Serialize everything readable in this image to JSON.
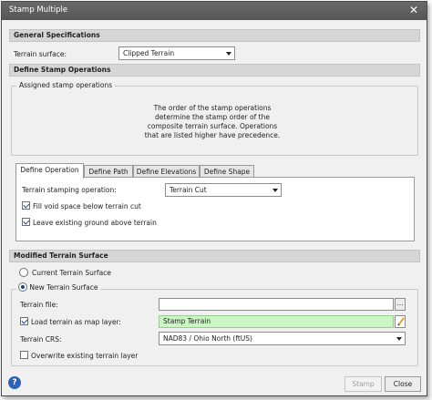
{
  "window": {
    "title": "Stamp Multiple",
    "close_glyph": "✕"
  },
  "general": {
    "header": "General Specifications",
    "terrain_surface_label": "Terrain surface:",
    "terrain_surface_value": "Clipped Terrain"
  },
  "define_stamp": {
    "header": "Define Stamp Operations",
    "assigned_legend": "Assigned stamp operations",
    "note_lines": [
      "The order of the stamp operations",
      "determine the stamp order of the",
      "composite terrain surface. Operations",
      "that are listed higher have precedence."
    ]
  },
  "tabs": [
    {
      "label": "Define Operation",
      "active": true
    },
    {
      "label": "Define Path",
      "active": false
    },
    {
      "label": "Define Elevations",
      "active": false
    },
    {
      "label": "Define Shape",
      "active": false
    }
  ],
  "operation": {
    "stamping_label": "Terrain stamping operation:",
    "stamping_value": "Terrain Cut",
    "fill_void_label": "Fill void space below terrain cut",
    "fill_void_checked": true,
    "leave_ground_label": "Leave existing ground above terrain",
    "leave_ground_checked": true
  },
  "modified": {
    "header": "Modified Terrain Surface",
    "current_label": "Current Terrain Surface",
    "current_selected": false,
    "new_legend": "New Terrain Surface",
    "new_selected": true,
    "terrain_file_label": "Terrain file:",
    "terrain_file_value": "",
    "browse_label": "...",
    "load_map_label": "Load terrain as map layer:",
    "load_map_checked": true,
    "layer_name_value": "Stamp Terrain",
    "crs_label": "Terrain CRS:",
    "crs_value": "NAD83 / Ohio North (ftUS)",
    "overwrite_label": "Overwrite existing terrain layer",
    "overwrite_checked": false
  },
  "footer": {
    "help_glyph": "?",
    "stamp_label": "Stamp",
    "close_label": "Close"
  },
  "icons": {
    "close": "close-icon",
    "pencil": "pencil-icon",
    "help": "help-icon",
    "dropdown": "chevron-down-icon"
  }
}
